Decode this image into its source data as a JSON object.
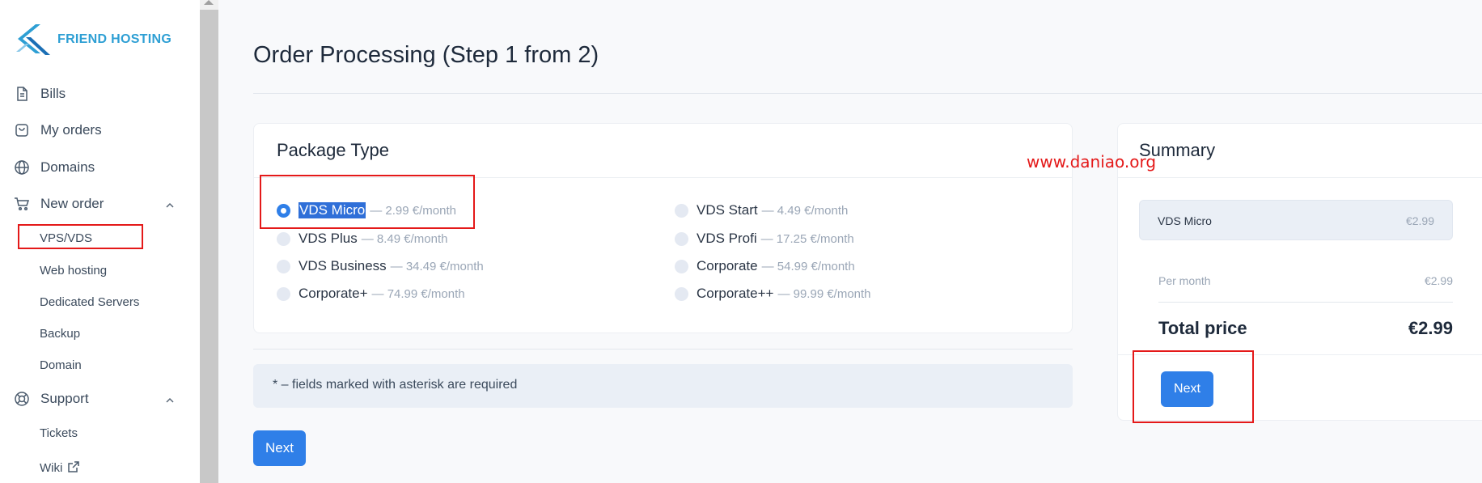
{
  "brand": {
    "name": "FRIEND HOSTING",
    "color": "#2e9fd4"
  },
  "sidebar": {
    "items": [
      {
        "label": "Bills",
        "icon": "document-icon"
      },
      {
        "label": "My orders",
        "icon": "bag-icon"
      },
      {
        "label": "Domains",
        "icon": "globe-icon"
      },
      {
        "label": "New order",
        "icon": "cart-icon",
        "expanded": true
      },
      {
        "label": "Support",
        "icon": "lifebuoy-icon",
        "expanded": true
      }
    ],
    "new_order_sub": [
      "VPS/VDS",
      "Web hosting",
      "Dedicated Servers",
      "Backup",
      "Domain"
    ],
    "support_sub": [
      "Tickets",
      "Wiki"
    ]
  },
  "page": {
    "title": "Order Processing (Step 1 from 2)"
  },
  "package": {
    "title": "Package Type",
    "options": [
      {
        "name": "VDS Micro",
        "price": "— 2.99 €/month",
        "selected": true
      },
      {
        "name": "VDS Start",
        "price": "— 4.49 €/month",
        "selected": false
      },
      {
        "name": "VDS Plus",
        "price": "— 8.49 €/month",
        "selected": false
      },
      {
        "name": "VDS Profi",
        "price": "— 17.25 €/month",
        "selected": false
      },
      {
        "name": "VDS Business",
        "price": "— 34.49 €/month",
        "selected": false
      },
      {
        "name": "Corporate",
        "price": "— 54.99 €/month",
        "selected": false
      },
      {
        "name": "Corporate+",
        "price": "— 74.99 €/month",
        "selected": false
      },
      {
        "name": "Corporate++",
        "price": "— 99.99 €/month",
        "selected": false
      }
    ]
  },
  "note": "* – fields marked with asterisk are required",
  "buttons": {
    "next": "Next"
  },
  "summary": {
    "title": "Summary",
    "item_name": "VDS Micro",
    "item_price": "€2.99",
    "per_month_label": "Per month",
    "per_month_value": "€2.99",
    "total_label": "Total price",
    "total_value": "€2.99"
  },
  "watermark": "www.daniao.org",
  "colors": {
    "accent": "#2f7fe8",
    "annotation": "#e41919"
  }
}
